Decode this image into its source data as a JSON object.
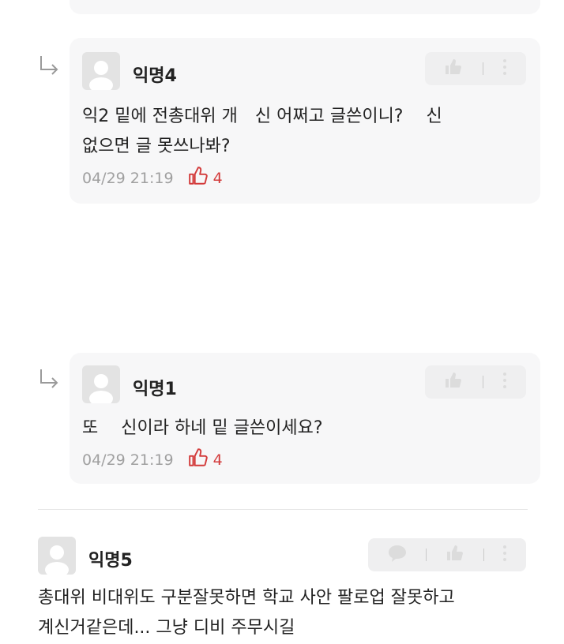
{
  "comments": [
    {
      "author": "익명4",
      "line1": "익2 밑에 전총대위 개　신 어쩌고 글쓴이니? 　신",
      "line2": "없으면 글 못쓰나봐?",
      "timestamp": "04/29 21:19",
      "likes": "4"
    },
    {
      "author": "익명1",
      "line1": "또 　신이라 하네 밑 글쓴이세요?",
      "timestamp": "04/29 21:19",
      "likes": "4"
    },
    {
      "author": "익명5",
      "line1": "총대위 비대위도 구분잘못하면 학교 사안 팔로업 잘못하고",
      "line2": "계신거같은데... 그냥 디비 주무시길"
    }
  ],
  "icons": {
    "reply": "reply-arrow-icon",
    "like": "thumbs-up-icon",
    "more": "more-vertical-icon",
    "comment": "speech-bubble-icon",
    "heart_like": "thumbs-up-outline-icon"
  },
  "colors": {
    "accent": "#d33b3b",
    "card": "#f7f7f8",
    "meta": "#a0a0a0"
  }
}
